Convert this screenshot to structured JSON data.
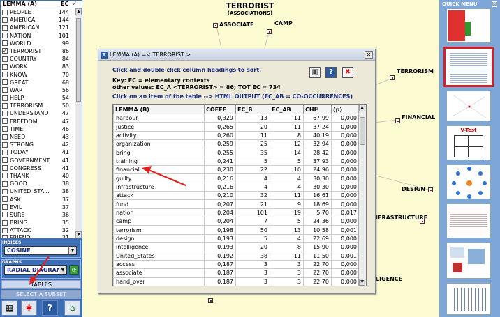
{
  "left_panel": {
    "header": {
      "lemma": "LEMMA (A)",
      "ec": "EC"
    },
    "lemmas": [
      {
        "name": "PEOPLE",
        "ec": "144",
        "checked": false
      },
      {
        "name": "AMERICA",
        "ec": "144",
        "checked": false
      },
      {
        "name": "AMERICAN",
        "ec": "121",
        "checked": false
      },
      {
        "name": "NATION",
        "ec": "101",
        "checked": false
      },
      {
        "name": "WORLD",
        "ec": "99",
        "checked": false
      },
      {
        "name": "TERRORIST",
        "ec": "86",
        "checked": true
      },
      {
        "name": "COUNTRY",
        "ec": "84",
        "checked": false
      },
      {
        "name": "WORK",
        "ec": "83",
        "checked": false
      },
      {
        "name": "KNOW",
        "ec": "70",
        "checked": false
      },
      {
        "name": "GREAT",
        "ec": "68",
        "checked": false
      },
      {
        "name": "WAR",
        "ec": "56",
        "checked": false
      },
      {
        "name": "HELP",
        "ec": "54",
        "checked": false
      },
      {
        "name": "TERRORISM",
        "ec": "50",
        "checked": false
      },
      {
        "name": "UNDERSTAND",
        "ec": "47",
        "checked": false
      },
      {
        "name": "FREEDOM",
        "ec": "47",
        "checked": false
      },
      {
        "name": "TIME",
        "ec": "46",
        "checked": false
      },
      {
        "name": "NEED",
        "ec": "43",
        "checked": false
      },
      {
        "name": "STRONG",
        "ec": "42",
        "checked": false
      },
      {
        "name": "TODAY",
        "ec": "41",
        "checked": false
      },
      {
        "name": "GOVERNMENT",
        "ec": "41",
        "checked": false
      },
      {
        "name": "CONGRESS",
        "ec": "41",
        "checked": false
      },
      {
        "name": "THANK",
        "ec": "40",
        "checked": false
      },
      {
        "name": "GOOD",
        "ec": "38",
        "checked": false
      },
      {
        "name": "UNITED_STA...",
        "ec": "38",
        "checked": false
      },
      {
        "name": "ASK",
        "ec": "37",
        "checked": false
      },
      {
        "name": "EVIL",
        "ec": "37",
        "checked": false
      },
      {
        "name": "SURE",
        "ec": "36",
        "checked": false
      },
      {
        "name": "BRING",
        "ec": "35",
        "checked": false
      },
      {
        "name": "ATTACK",
        "ec": "32",
        "checked": false
      },
      {
        "name": "FRIEND",
        "ec": "31",
        "checked": false
      }
    ],
    "indices_label": "INDICES",
    "indices_value": "COSINE",
    "graphs_label": "GRAPHS",
    "graphs_value": "RADIAL DIAGRAM",
    "tables_button": "TABLES",
    "subset_button": "SELECT A SUBSET"
  },
  "map": {
    "title": "TERRORIST",
    "subtitle": "(ASSOCIATIONS)",
    "nodes": [
      "ASSOCIATE",
      "CAMP",
      "TERRORISM",
      "FINANCIAL",
      "DESIGN",
      "IFRASTRUCTURE",
      "LIGENCE"
    ]
  },
  "dialog": {
    "title": "LEMMA (A) =< TERRORIST >",
    "instruction": "Click and double click column headings to sort.",
    "key_line": "Key: EC = elementary contexts",
    "values_line": "other values: EC_A <TERRORIST> = 86; TOT EC = 734",
    "output_line": "Click on an item of the table --> HTML OUTPUT (EC_AB = CO-OCCURRENCES)",
    "columns": [
      "LEMMA (B)",
      "COEFF",
      "EC_B",
      "EC_AB",
      "CHI²",
      "(p)"
    ],
    "rows": [
      [
        "harbour",
        "0,329",
        "13",
        "11",
        "67,99",
        "0,000"
      ],
      [
        "justice",
        "0,265",
        "20",
        "11",
        "37,24",
        "0,000"
      ],
      [
        "activity",
        "0,260",
        "11",
        "8",
        "40,19",
        "0,000"
      ],
      [
        "organization",
        "0,259",
        "25",
        "12",
        "32,94",
        "0,000"
      ],
      [
        "bring",
        "0,255",
        "35",
        "14",
        "28,42",
        "0,000"
      ],
      [
        "training",
        "0,241",
        "5",
        "5",
        "37,93",
        "0,000"
      ],
      [
        "financial",
        "0,230",
        "22",
        "10",
        "24,96",
        "0,000"
      ],
      [
        "guilty",
        "0,216",
        "4",
        "4",
        "30,30",
        "0,000"
      ],
      [
        "infrastructure",
        "0,216",
        "4",
        "4",
        "30,30",
        "0,000"
      ],
      [
        "attack",
        "0,210",
        "32",
        "11",
        "16,61",
        "0,000"
      ],
      [
        "fund",
        "0,207",
        "21",
        "9",
        "18,69",
        "0,000"
      ],
      [
        "nation",
        "0,204",
        "101",
        "19",
        "5,70",
        "0,017"
      ],
      [
        "camp",
        "0,204",
        "7",
        "5",
        "24,36",
        "0,000"
      ],
      [
        "terrorism",
        "0,198",
        "50",
        "13",
        "10,58",
        "0,001"
      ],
      [
        "design",
        "0,193",
        "5",
        "4",
        "22,69",
        "0,000"
      ],
      [
        "intelligence",
        "0,193",
        "20",
        "8",
        "15,90",
        "0,000"
      ],
      [
        "United_States",
        "0,192",
        "38",
        "11",
        "11,50",
        "0,001"
      ],
      [
        "access",
        "0,187",
        "3",
        "3",
        "22,70",
        "0,000"
      ],
      [
        "associate",
        "0,187",
        "3",
        "3",
        "22,70",
        "0,000"
      ],
      [
        "hand_over",
        "0,187",
        "3",
        "3",
        "22,70",
        "0,000"
      ]
    ]
  },
  "right_panel": {
    "label": "QUICK MENU",
    "thumb_label": "V-Test"
  },
  "colors": {
    "panel_blue": "#3d6fb8",
    "dialog_blue_text": "#1c2d8a",
    "selected_red": "#d42020",
    "map_bg": "#fdfbd2"
  }
}
